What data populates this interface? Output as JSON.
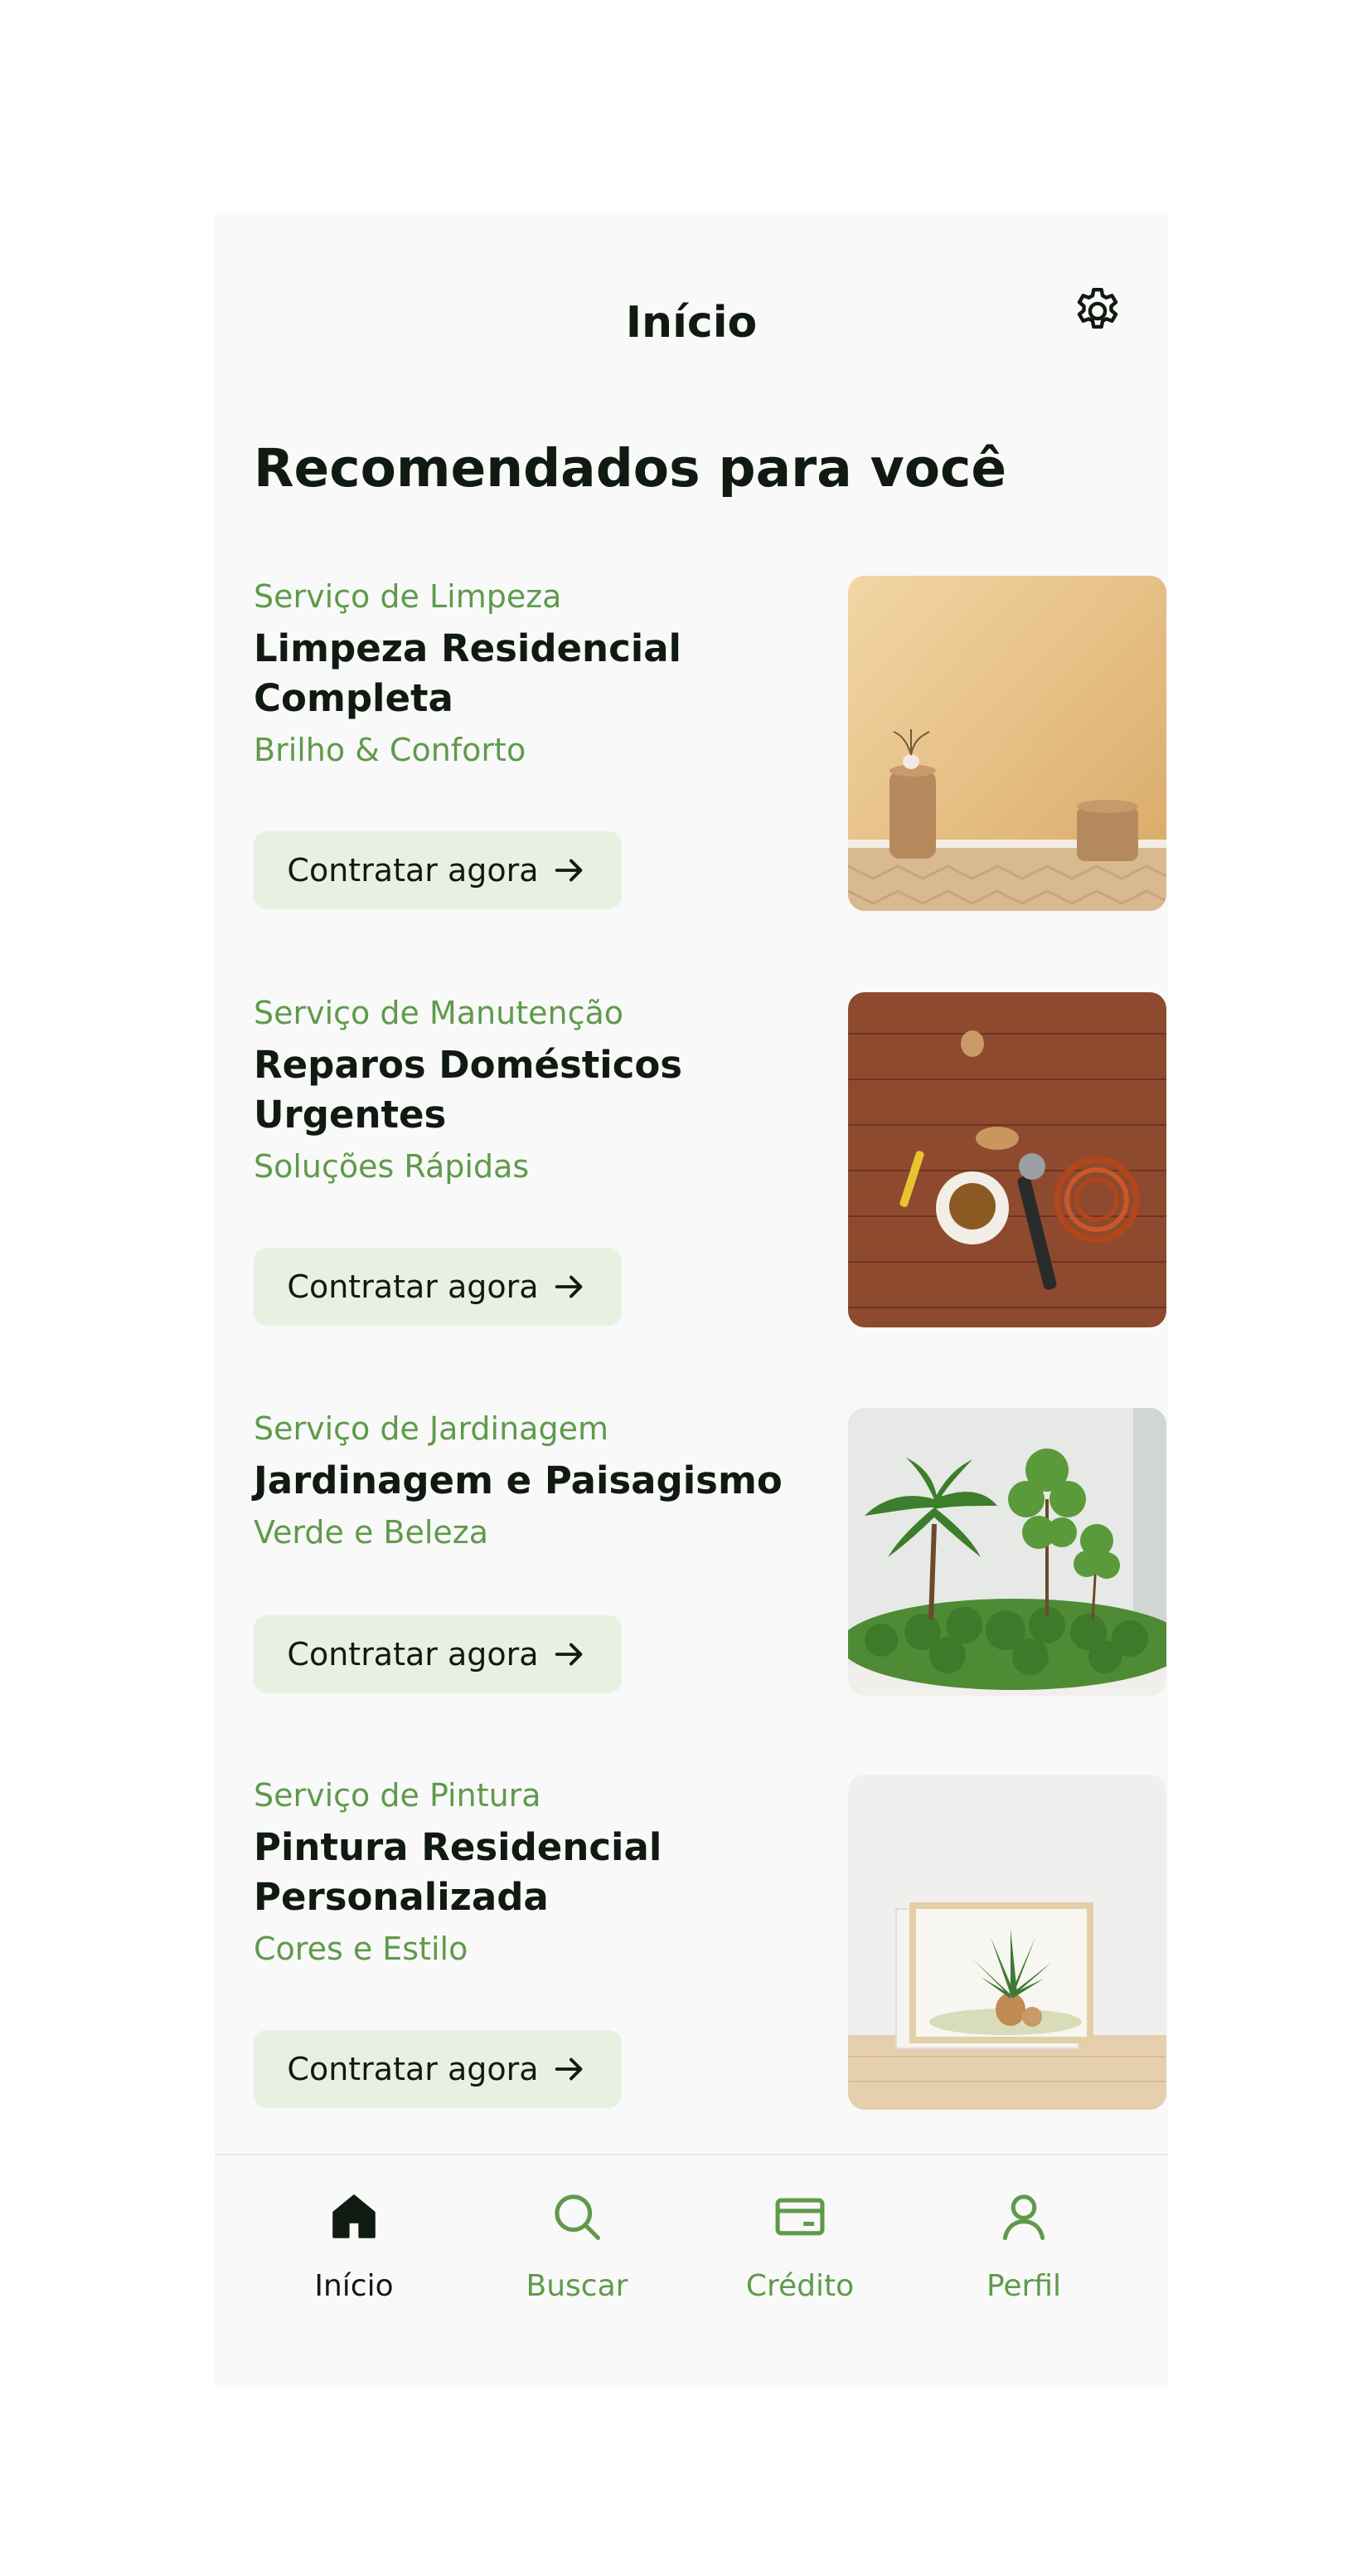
{
  "header": {
    "title": "Início",
    "settings_icon": "gear-icon"
  },
  "section_title": "Recomendados para você",
  "colors": {
    "accent": "#5f9a4c",
    "cta_bg": "#e8f0e2",
    "text": "#111a11",
    "background": "#f9f9f9"
  },
  "cards": [
    {
      "category": "Serviço de Limpeza",
      "title_lines": [
        "Limpeza Residencial",
        "Completa"
      ],
      "tagline": "Brilho & Conforto",
      "cta": "Contratar agora",
      "image": "living-room-vases-image"
    },
    {
      "category": "Serviço de Manutenção",
      "title_lines": [
        "Reparos Domésticos",
        "Urgentes"
      ],
      "tagline": "Soluções Rápidas",
      "cta": "Contratar agora",
      "image": "tools-on-wood-image"
    },
    {
      "category": "Serviço de Jardinagem",
      "title_lines": [
        "Jardinagem e Paisagismo"
      ],
      "tagline": "Verde e Beleza",
      "cta": "Contratar agora",
      "image": "garden-plants-image"
    },
    {
      "category": "Serviço de Pintura",
      "title_lines": [
        "Pintura Residencial",
        "Personalizada"
      ],
      "tagline": "Cores e Estilo",
      "cta": "Contratar agora",
      "image": "framed-plant-painting-image"
    }
  ],
  "tabbar": {
    "items": [
      {
        "label": "Início",
        "icon": "home-icon",
        "active": true
      },
      {
        "label": "Buscar",
        "icon": "search-icon",
        "active": false
      },
      {
        "label": "Crédito",
        "icon": "credit-card-icon",
        "active": false
      },
      {
        "label": "Perfil",
        "icon": "user-icon",
        "active": false
      }
    ]
  }
}
